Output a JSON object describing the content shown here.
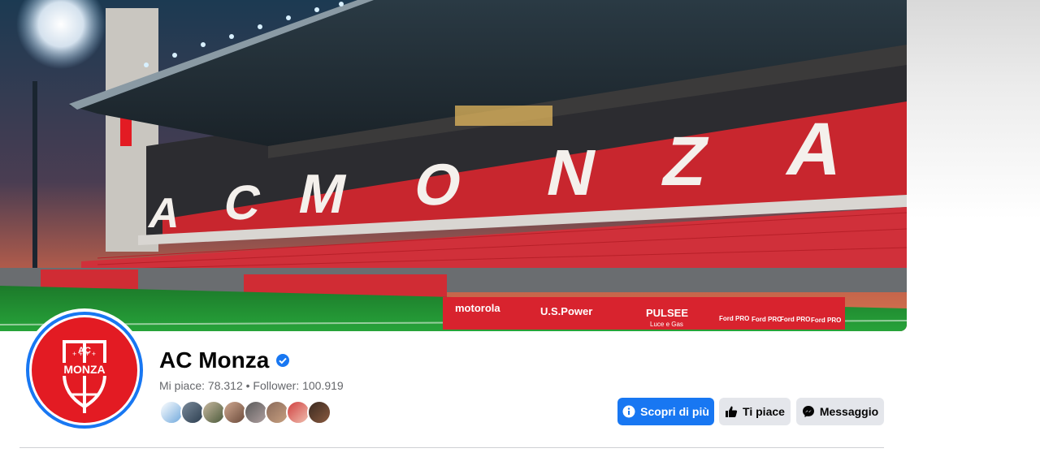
{
  "page": {
    "name": "AC Monza",
    "stats": "Mi piace: 78.312 • Follower: 100.919"
  },
  "actions": {
    "learn_more": "Scopri di più",
    "like": "Ti piace",
    "message": "Messaggio"
  },
  "logo": {
    "top_text": "AC",
    "main_text": "MONZA"
  },
  "cover": {
    "stand_letters": [
      "A",
      "C",
      "M",
      "O",
      "N",
      "Z",
      "A"
    ],
    "sponsors": [
      "motorola",
      "U.S.Power",
      "PULSEE",
      "Luce e Gas",
      "Ford PRO"
    ]
  },
  "friends_count_shown": 8,
  "colors": {
    "accent": "#1877f2",
    "brand_red": "#e31b23",
    "button_gray": "#e4e6eb",
    "muted_text": "#65676b"
  },
  "icons": [
    "verified-badge-icon",
    "info-icon",
    "thumbs-up-icon",
    "messenger-icon"
  ]
}
